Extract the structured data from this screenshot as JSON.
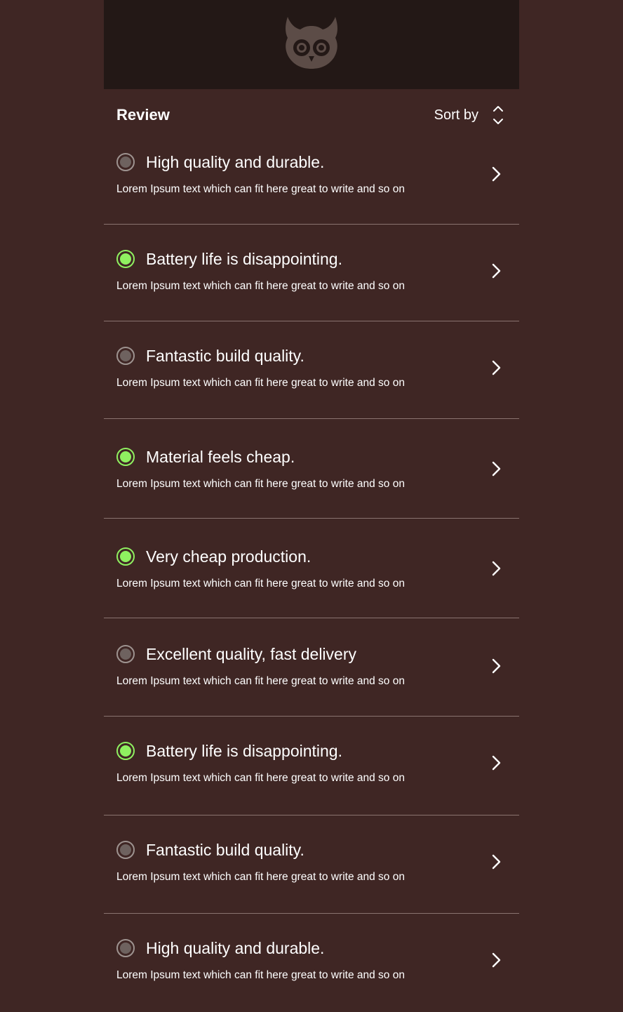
{
  "header": {
    "logo_icon": "owl-icon"
  },
  "review": {
    "title": "Review",
    "sort_label": "Sort by",
    "sort_icon": "sort-up-down-icon"
  },
  "colors": {
    "background": "#3f2624",
    "header_bg": "#231816",
    "active_dot": "#8ff060",
    "inactive_dot": "#6e625f"
  },
  "items": [
    {
      "title": "High quality and durable.",
      "description": "Lorem Ipsum text which can fit here great to write and so on",
      "selected": false
    },
    {
      "title": "Battery life is disappointing.",
      "description": "Lorem Ipsum text which can fit here great to write and so on",
      "selected": true
    },
    {
      "title": "Fantastic build quality.",
      "description": "Lorem Ipsum text which can fit here great to write and so on",
      "selected": false
    },
    {
      "title": "Material feels cheap.",
      "description": "Lorem Ipsum text which can fit here great to write and so on",
      "selected": true
    },
    {
      "title": "Very cheap production.",
      "description": "Lorem Ipsum text which can fit here great to write and so on",
      "selected": true
    },
    {
      "title": "Excellent quality, fast delivery",
      "description": "Lorem Ipsum text which can fit here great to write and so on",
      "selected": false
    },
    {
      "title": "Battery life is disappointing.",
      "description": "Lorem Ipsum text which can fit here great to write and so on",
      "selected": true
    },
    {
      "title": "Fantastic build quality.",
      "description": "Lorem Ipsum text which can fit here great to write and so on",
      "selected": false
    },
    {
      "title": "High quality and durable.",
      "description": "Lorem Ipsum text which can fit here great to write and so on",
      "selected": false
    }
  ]
}
